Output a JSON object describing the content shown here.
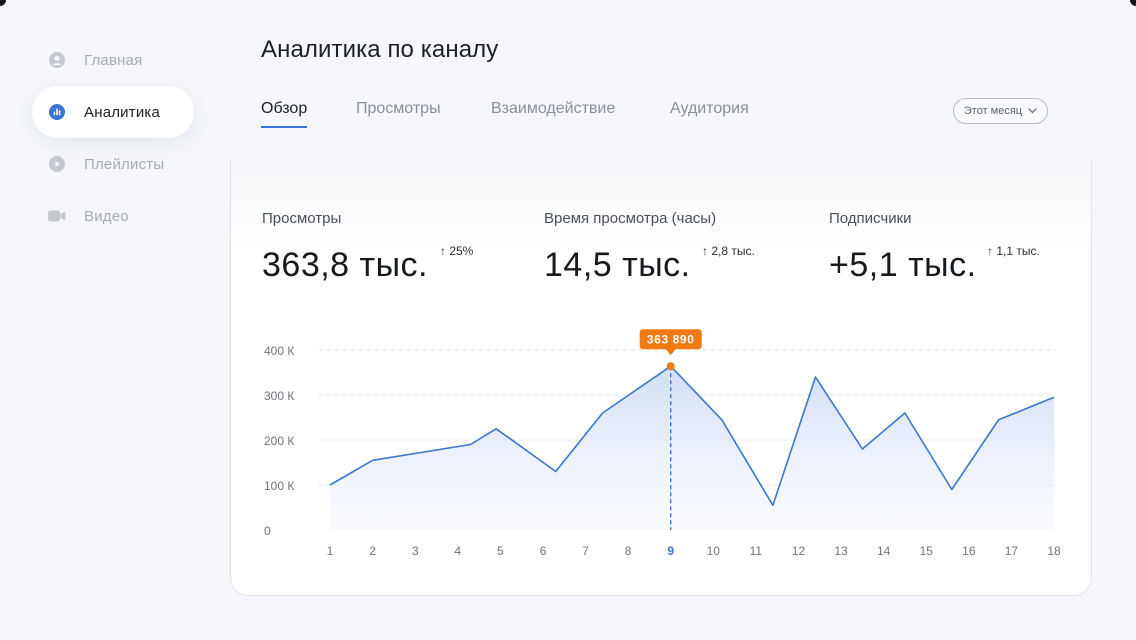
{
  "sidebar": {
    "items": [
      {
        "label": "Главная",
        "icon": "user-circle-icon",
        "active": false
      },
      {
        "label": "Аналитика",
        "icon": "analytics-icon",
        "active": true
      },
      {
        "label": "Плейлисты",
        "icon": "play-circle-icon",
        "active": false
      },
      {
        "label": "Видео",
        "icon": "video-camera-icon",
        "active": false
      }
    ]
  },
  "header": {
    "title": "Аналитика по каналу",
    "tabs": [
      "Обзор",
      "Просмотры",
      "Взаимодействие",
      "Аудитория"
    ],
    "active_tab": "Обзор",
    "period": "Этот месяц"
  },
  "stats": [
    {
      "label": "Просмотры",
      "value": "363,8 тыс.",
      "delta": "↑ 25%"
    },
    {
      "label": "Время просмотра (часы)",
      "value": "14,5 тыс.",
      "delta": "↑ 2,8 тыс."
    },
    {
      "label": "Подписчики",
      "value": "+5,1 тыс.",
      "delta": "↑ 1,1 тыс."
    }
  ],
  "colors": {
    "accent": "#3d73d6",
    "line": "#3a78c9",
    "highlight": "#f07a12",
    "text": "#1c1f24",
    "muted": "#a7acb4"
  },
  "chart_data": {
    "type": "area",
    "x": [
      1,
      2,
      3,
      4,
      5,
      6,
      7,
      8,
      9,
      10,
      11,
      12,
      13,
      14,
      15,
      16,
      17,
      18
    ],
    "values": [
      100000,
      155000,
      190000,
      225000,
      205000,
      130000,
      260000,
      363890,
      245000,
      55000,
      340000,
      180000,
      260000,
      90000,
      245000,
      295000
    ],
    "x_points": [
      1,
      2,
      4.3,
      4.9,
      5.2,
      6.3,
      7.4,
      9,
      10.2,
      11.4,
      12.4,
      13.5,
      14.5,
      15.6,
      16.7,
      18
    ],
    "y_ticks": [
      "0",
      "100 К",
      "200 К",
      "300 К",
      "400 К"
    ],
    "ylim": [
      0,
      400000
    ],
    "highlight": {
      "x": 9,
      "label": "363 890"
    },
    "grid": true
  }
}
